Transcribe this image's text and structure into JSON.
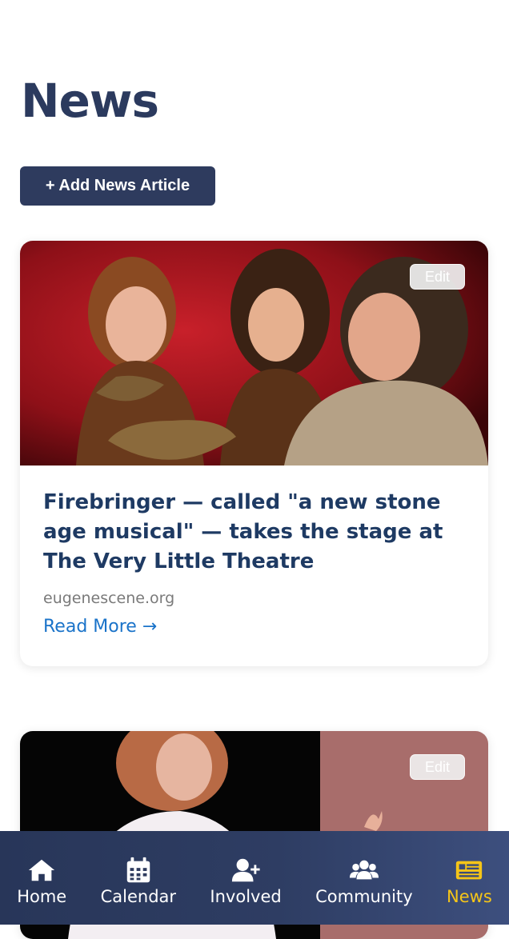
{
  "page": {
    "title": "News",
    "add_button_label": "+ Add News Article"
  },
  "articles": [
    {
      "title": "Firebringer — called \"a new stone age musical\" — takes the stage at The Very Little Theatre",
      "source": "eugenescene.org",
      "read_more_label": "Read More →",
      "edit_label": "Edit"
    },
    {
      "edit_label": "Edit"
    }
  ],
  "nav": {
    "items": [
      {
        "label": "Home",
        "icon": "home-icon"
      },
      {
        "label": "Calendar",
        "icon": "calendar-icon"
      },
      {
        "label": "Involved",
        "icon": "user-plus-icon"
      },
      {
        "label": "Community",
        "icon": "users-icon"
      },
      {
        "label": "News",
        "icon": "newspaper-icon",
        "active": true
      }
    ]
  },
  "colors": {
    "primary": "#2e3b5e",
    "title": "#1e3a63",
    "link": "#1a73c9",
    "active_nav": "#f5c518"
  }
}
